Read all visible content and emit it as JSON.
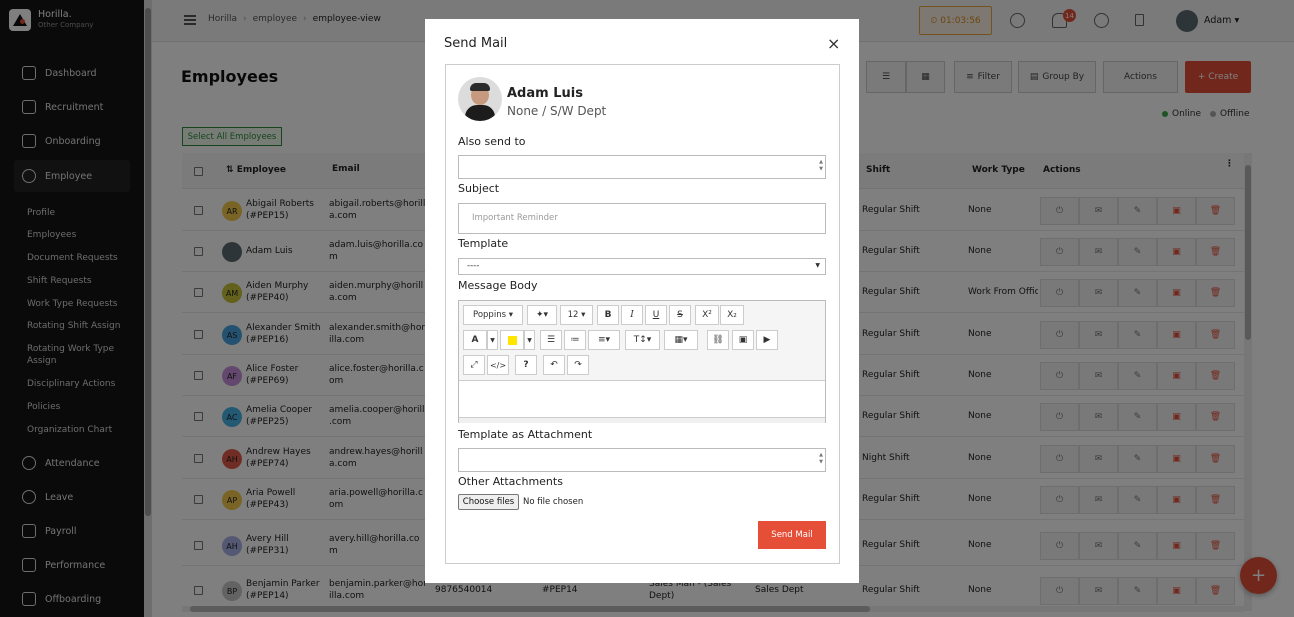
{
  "app": {
    "name": "Horilla.",
    "company": "Other Company"
  },
  "sidebar": {
    "items": [
      {
        "label": "Dashboard",
        "icon": "grid-icon"
      },
      {
        "label": "Recruitment",
        "icon": "phone-icon"
      },
      {
        "label": "Onboarding",
        "icon": "rocket-icon"
      },
      {
        "label": "Employee",
        "icon": "users-icon"
      },
      {
        "label": "Attendance",
        "icon": "clock-icon"
      },
      {
        "label": "Leave",
        "icon": "leave-icon"
      },
      {
        "label": "Payroll",
        "icon": "wallet-icon"
      },
      {
        "label": "Performance",
        "icon": "trend-icon"
      },
      {
        "label": "Offboarding",
        "icon": "exit-icon"
      }
    ],
    "subitems": [
      "Profile",
      "Employees",
      "Document Requests",
      "Shift Requests",
      "Work Type Requests",
      "Rotating Shift Assign",
      "Rotating Work Type Assign",
      "Disciplinary Actions",
      "Policies",
      "Organization Chart"
    ]
  },
  "header": {
    "breadcrumbs": [
      "Horilla",
      "employee",
      "employee-view"
    ],
    "timer": "⏲ 01:03:56",
    "notifications": "14",
    "user": "Adam"
  },
  "main": {
    "title": "Employees",
    "filter_label": "Filter",
    "group_by_label": "Group By",
    "actions_label": "Actions",
    "create_label": "+ Create",
    "legend_online": "Online",
    "legend_offline": "Offline",
    "select_all": "Select All Employees",
    "columns": [
      "Employee",
      "Email",
      "Shift",
      "Work Type",
      "Actions"
    ],
    "rows": [
      {
        "initials": "AR",
        "name": "Abigail Roberts",
        "badge": "(#PEP15)",
        "email1": "abigail.roberts@horill",
        "email2": "a.com",
        "shift": "Regular Shift",
        "work": "None",
        "color": "#f2c84b"
      },
      {
        "initials": "",
        "name": "Adam Luis",
        "badge": "",
        "email1": "adam.luis@horilla.co",
        "email2": "m",
        "shift": "Regular Shift",
        "work": "None",
        "color": "#5c6b73"
      },
      {
        "initials": "AM",
        "name": "Aiden Murphy",
        "badge": "(#PEP40)",
        "email1": "aiden.murphy@horill",
        "email2": "a.com",
        "shift": "Regular Shift",
        "work": "Work From Offic",
        "color": "#c8c23a"
      },
      {
        "initials": "AS",
        "name": "Alexander Smith",
        "badge": "(#PEP16)",
        "email1": "alexander.smith@hor",
        "email2": "illa.com",
        "shift": "Regular Shift",
        "work": "None",
        "color": "#4aa3e0"
      },
      {
        "initials": "AF",
        "name": "Alice Foster",
        "badge": "(#PEP69)",
        "email1": "alice.foster@horilla.c",
        "email2": "om",
        "shift": "Regular Shift",
        "work": "None",
        "color": "#c98fd9"
      },
      {
        "initials": "AC",
        "name": "Amelia Cooper",
        "badge": "(#PEP25)",
        "email1": "amelia.cooper@horilla",
        "email2": ".com",
        "shift": "Regular Shift",
        "work": "None",
        "color": "#49b3e8"
      },
      {
        "initials": "AH",
        "name": "Andrew Hayes",
        "badge": "(#PEP74)",
        "email1": "andrew.hayes@horill",
        "email2": "a.com",
        "shift": "Night Shift",
        "work": "None",
        "color": "#e05b4b"
      },
      {
        "initials": "AP",
        "name": "Aria Powell",
        "badge": "(#PEP43)",
        "email1": "aria.powell@horilla.c",
        "email2": "om",
        "shift": "Regular Shift",
        "work": "None",
        "color": "#f2c84b"
      },
      {
        "initials": "AH",
        "name": "Avery Hill",
        "badge": "(#PEP31)",
        "email1": "avery.hill@horilla.co",
        "email2": "m",
        "shift": "Regular Shift",
        "work": "None",
        "color": "#a8b0e6"
      },
      {
        "initials": "BP",
        "name": "Benjamin Parker",
        "badge": "(#PEP14)",
        "email1": "benjamin.parker@hor",
        "email2": "illa.com",
        "phone": "9876540014",
        "badge_id": "#PEP14",
        "job1": "Sales Man - (Sales",
        "job2": "Dept)",
        "dept": "Sales Dept",
        "shift": "Regular Shift",
        "work": "None",
        "color": "#c7c7c7"
      }
    ]
  },
  "modal": {
    "title": "Send Mail",
    "close": "×",
    "employee_name": "Adam Luis",
    "employee_dept": "None / S/W Dept",
    "also_send_to_label": "Also send to",
    "subject_label": "Subject",
    "subject_placeholder": "Important Reminder",
    "template_label": "Template",
    "template_value": "----",
    "message_label": "Message Body",
    "font_name": "Poppins",
    "font_size": "12",
    "template_attachment_label": "Template as Attachment",
    "other_attachments_label": "Other Attachments",
    "choose_files": "Choose files",
    "no_file": "No file chosen",
    "send_button": "Send Mail"
  }
}
